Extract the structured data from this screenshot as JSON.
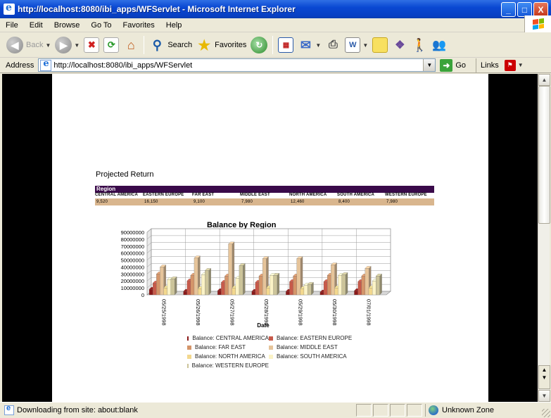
{
  "window": {
    "title": "http://localhost:8080/ibi_apps/WFServlet - Microsoft Internet Explorer",
    "minimize": "_",
    "maximize": "□",
    "close": "X"
  },
  "menu": [
    "File",
    "Edit",
    "Browse",
    "Go To",
    "Favorites",
    "Help"
  ],
  "toolbar": {
    "back_label": "Back",
    "search_label": "Search",
    "favorites_label": "Favorites"
  },
  "address": {
    "label": "Address",
    "url": "http://localhost:8080/ibi_apps/WFServlet",
    "go_label": "Go",
    "links_label": "Links"
  },
  "report": {
    "title": "Projected Return",
    "group_header": "Region",
    "columns": [
      "CENTRAL AMERICA",
      "EASTERN EUROPE",
      "FAR EAST",
      "MIDDLE EAST",
      "NORTH AMERICA",
      "SOUTH AMERICA",
      "WESTERN EUROPE"
    ],
    "values": [
      "9,520",
      "16,150",
      "9,100",
      "7,980",
      "12,460",
      "8,400",
      "7,980"
    ]
  },
  "chart_data": {
    "type": "bar",
    "title": "Balance by Region",
    "xlabel": "Date",
    "ylabel": "",
    "ylim": [
      0,
      90000000
    ],
    "yticks": [
      "90000000",
      "80000000",
      "70000000",
      "60000000",
      "50000000",
      "40000000",
      "30000000",
      "20000000",
      "10000000",
      "0"
    ],
    "categories": [
      "05/25/1998",
      "05/26/1998",
      "05/27/1998",
      "05/28/1998",
      "05/29/1998",
      "05/30/1998",
      "07/01/1998"
    ],
    "series": [
      {
        "name": "Balance: CENTRAL AMERICA",
        "color": "#8b1a1a",
        "values": [
          8000000,
          5000000,
          6000000,
          5000000,
          5000000,
          4000000,
          6000000
        ]
      },
      {
        "name": "Balance: EASTERN EUROPE",
        "color": "#c75a4a",
        "values": [
          17000000,
          20000000,
          18000000,
          18000000,
          19000000,
          19000000,
          19000000
        ]
      },
      {
        "name": "Balance: FAR EAST",
        "color": "#d4956a",
        "values": [
          30000000,
          28000000,
          27000000,
          27000000,
          27000000,
          28000000,
          27000000
        ]
      },
      {
        "name": "Balance: MIDDLE EAST",
        "color": "#e6c49a",
        "values": [
          40000000,
          53000000,
          73000000,
          52000000,
          52000000,
          43000000,
          38000000
        ]
      },
      {
        "name": "Balance: NORTH AMERICA",
        "color": "#f3d88e",
        "values": [
          10000000,
          9000000,
          10000000,
          10000000,
          9000000,
          10000000,
          10000000
        ]
      },
      {
        "name": "Balance: SOUTH AMERICA",
        "color": "#fbf3c6",
        "values": [
          22000000,
          29000000,
          24000000,
          28000000,
          14000000,
          28000000,
          20000000
        ]
      },
      {
        "name": "Balance: WESTERN EUROPE",
        "color": "#ccc49a",
        "values": [
          23000000,
          35000000,
          42000000,
          28000000,
          15000000,
          29000000,
          27000000
        ]
      }
    ],
    "grid": true,
    "legend": "bottom"
  },
  "status": {
    "text": "Downloading from site: about:blank",
    "zone": "Unknown Zone"
  }
}
